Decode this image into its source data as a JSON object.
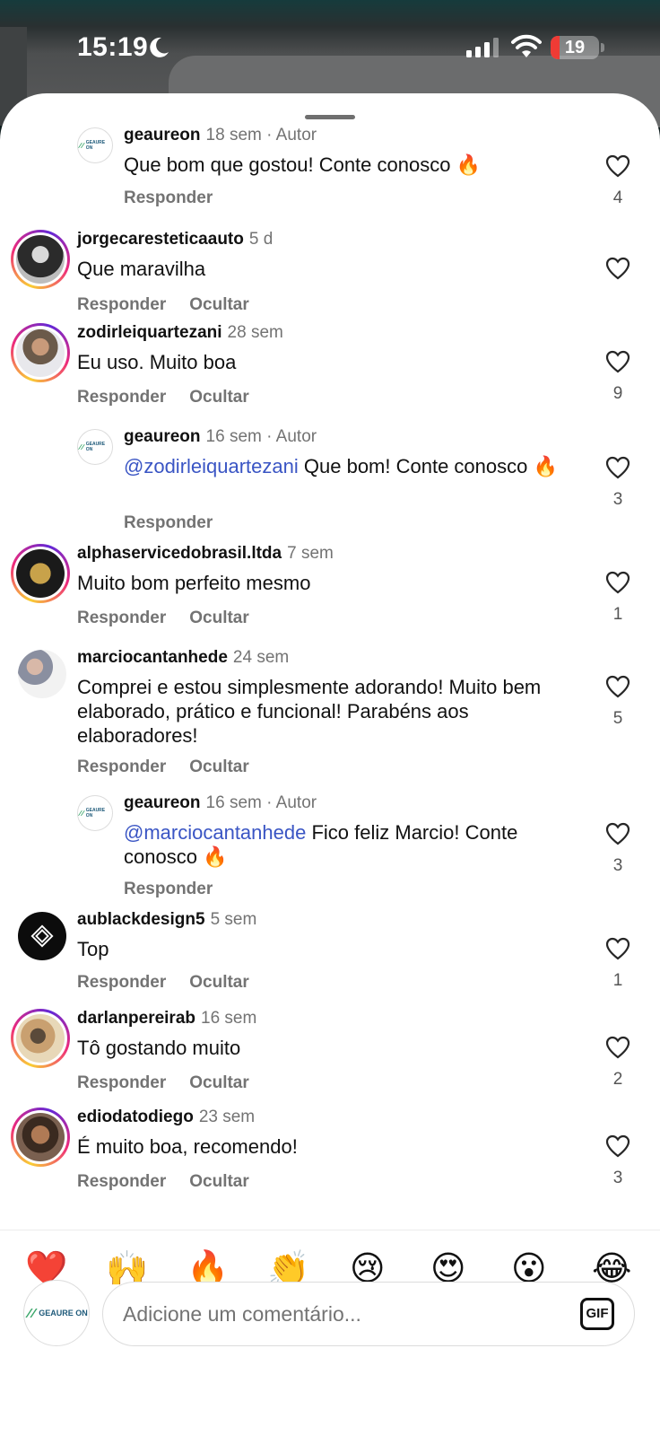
{
  "status_bar": {
    "time": "15:19",
    "battery_level": "19",
    "battery_fraction": 0.19
  },
  "comments": [
    {
      "user": "geaureon",
      "meta": "18 sem · Autor",
      "parts": [
        {
          "t": "Que bom que gostou! Conte conosco "
        },
        {
          "t": "🔥"
        }
      ],
      "reply_label": "Responder",
      "likes": "4"
    },
    {
      "user": "jorgecaresteticaauto",
      "meta": "5 d",
      "text": "Que maravilha",
      "reply_label": "Responder",
      "hide_label": "Ocultar",
      "likes": ""
    },
    {
      "user": "zodirleiquartezani",
      "meta": "28 sem",
      "text": "Eu uso. Muito boa",
      "reply_label": "Responder",
      "hide_label": "Ocultar",
      "likes": "9"
    },
    {
      "user": "geaureon",
      "meta": "16 sem · Autor",
      "mention": "@zodirleiquartezani",
      "text": " Que bom! Conte conosco 🔥",
      "reply_label": "Responder",
      "likes": "3"
    },
    {
      "user": "alphaservicedobrasil.ltda",
      "meta": "7 sem",
      "text": "Muito bom perfeito mesmo",
      "reply_label": "Responder",
      "hide_label": "Ocultar",
      "likes": "1"
    },
    {
      "user": "marciocantanhede",
      "meta": "24 sem",
      "text": "Comprei e estou simplesmente adorando! Muito bem elaborado, prático e funcional! Parabéns aos elaboradores!",
      "reply_label": "Responder",
      "hide_label": "Ocultar",
      "likes": "5"
    },
    {
      "user": "geaureon",
      "meta": "16 sem · Autor",
      "mention": "@marciocantanhede",
      "text": " Fico feliz Marcio! Conte conosco 🔥",
      "reply_label": "Responder",
      "likes": "3"
    },
    {
      "user": "aublackdesign5",
      "meta": "5 sem",
      "text": "Top",
      "reply_label": "Responder",
      "hide_label": "Ocultar",
      "likes": "1"
    },
    {
      "user": "darlanpereirab",
      "meta": "16 sem",
      "text": "Tô gostando muito",
      "reply_label": "Responder",
      "hide_label": "Ocultar",
      "likes": "2"
    },
    {
      "user": "ediodatodiego",
      "meta": "23 sem",
      "text": "É muito boa, recomendo!",
      "reply_label": "Responder",
      "hide_label": "Ocultar",
      "likes": "3"
    }
  ],
  "quick_reactions": [
    "❤️",
    "🙌",
    "🔥",
    "👏",
    "😢",
    "😍",
    "😮",
    "😂"
  ],
  "composer": {
    "placeholder": "Adicione um comentário...",
    "gif_label": "GIF",
    "avatar_text": "GEAURE ON"
  },
  "brand_text": "GEAURE ON",
  "colors": {
    "mention": "#3a55c4",
    "muted": "#737373",
    "battery_low": "#ef3b35"
  }
}
